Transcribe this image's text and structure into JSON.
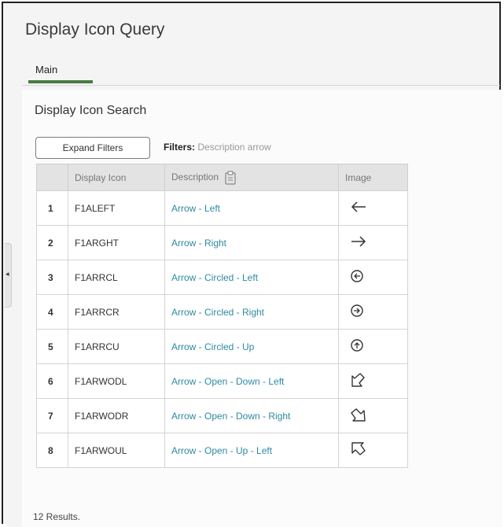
{
  "page": {
    "title": "Display Icon Query"
  },
  "tabs": [
    {
      "label": "Main"
    }
  ],
  "section": {
    "title": "Display Icon Search"
  },
  "filter_bar": {
    "expand_label": "Expand Filters",
    "filters_label": "Filters:",
    "filters_value": "Description arrow"
  },
  "table": {
    "headers": [
      "",
      "Display Icon",
      "Description",
      "Image"
    ],
    "rows": [
      {
        "num": "1",
        "code": "F1ALEFT",
        "desc": "Arrow - Left",
        "icon": "arrow-left"
      },
      {
        "num": "2",
        "code": "F1ARGHT",
        "desc": "Arrow - Right",
        "icon": "arrow-right"
      },
      {
        "num": "3",
        "code": "F1ARRCL",
        "desc": "Arrow - Circled - Left",
        "icon": "arrow-circled-left"
      },
      {
        "num": "4",
        "code": "F1ARRCR",
        "desc": "Arrow - Circled - Right",
        "icon": "arrow-circled-right"
      },
      {
        "num": "5",
        "code": "F1ARRCU",
        "desc": "Arrow - Circled - Up",
        "icon": "arrow-circled-up"
      },
      {
        "num": "6",
        "code": "F1ARWODL",
        "desc": "Arrow - Open - Down - Left",
        "icon": "arrow-open-down-left"
      },
      {
        "num": "7",
        "code": "F1ARWODR",
        "desc": "Arrow - Open - Down - Right",
        "icon": "arrow-open-down-right"
      },
      {
        "num": "8",
        "code": "F1ARWOUL",
        "desc": "Arrow - Open - Up - Left",
        "icon": "arrow-open-up-left"
      }
    ]
  },
  "footer": {
    "results": "12 Results."
  },
  "colors": {
    "tab_accent": "#4a7a45",
    "link": "#2e8aa0"
  }
}
